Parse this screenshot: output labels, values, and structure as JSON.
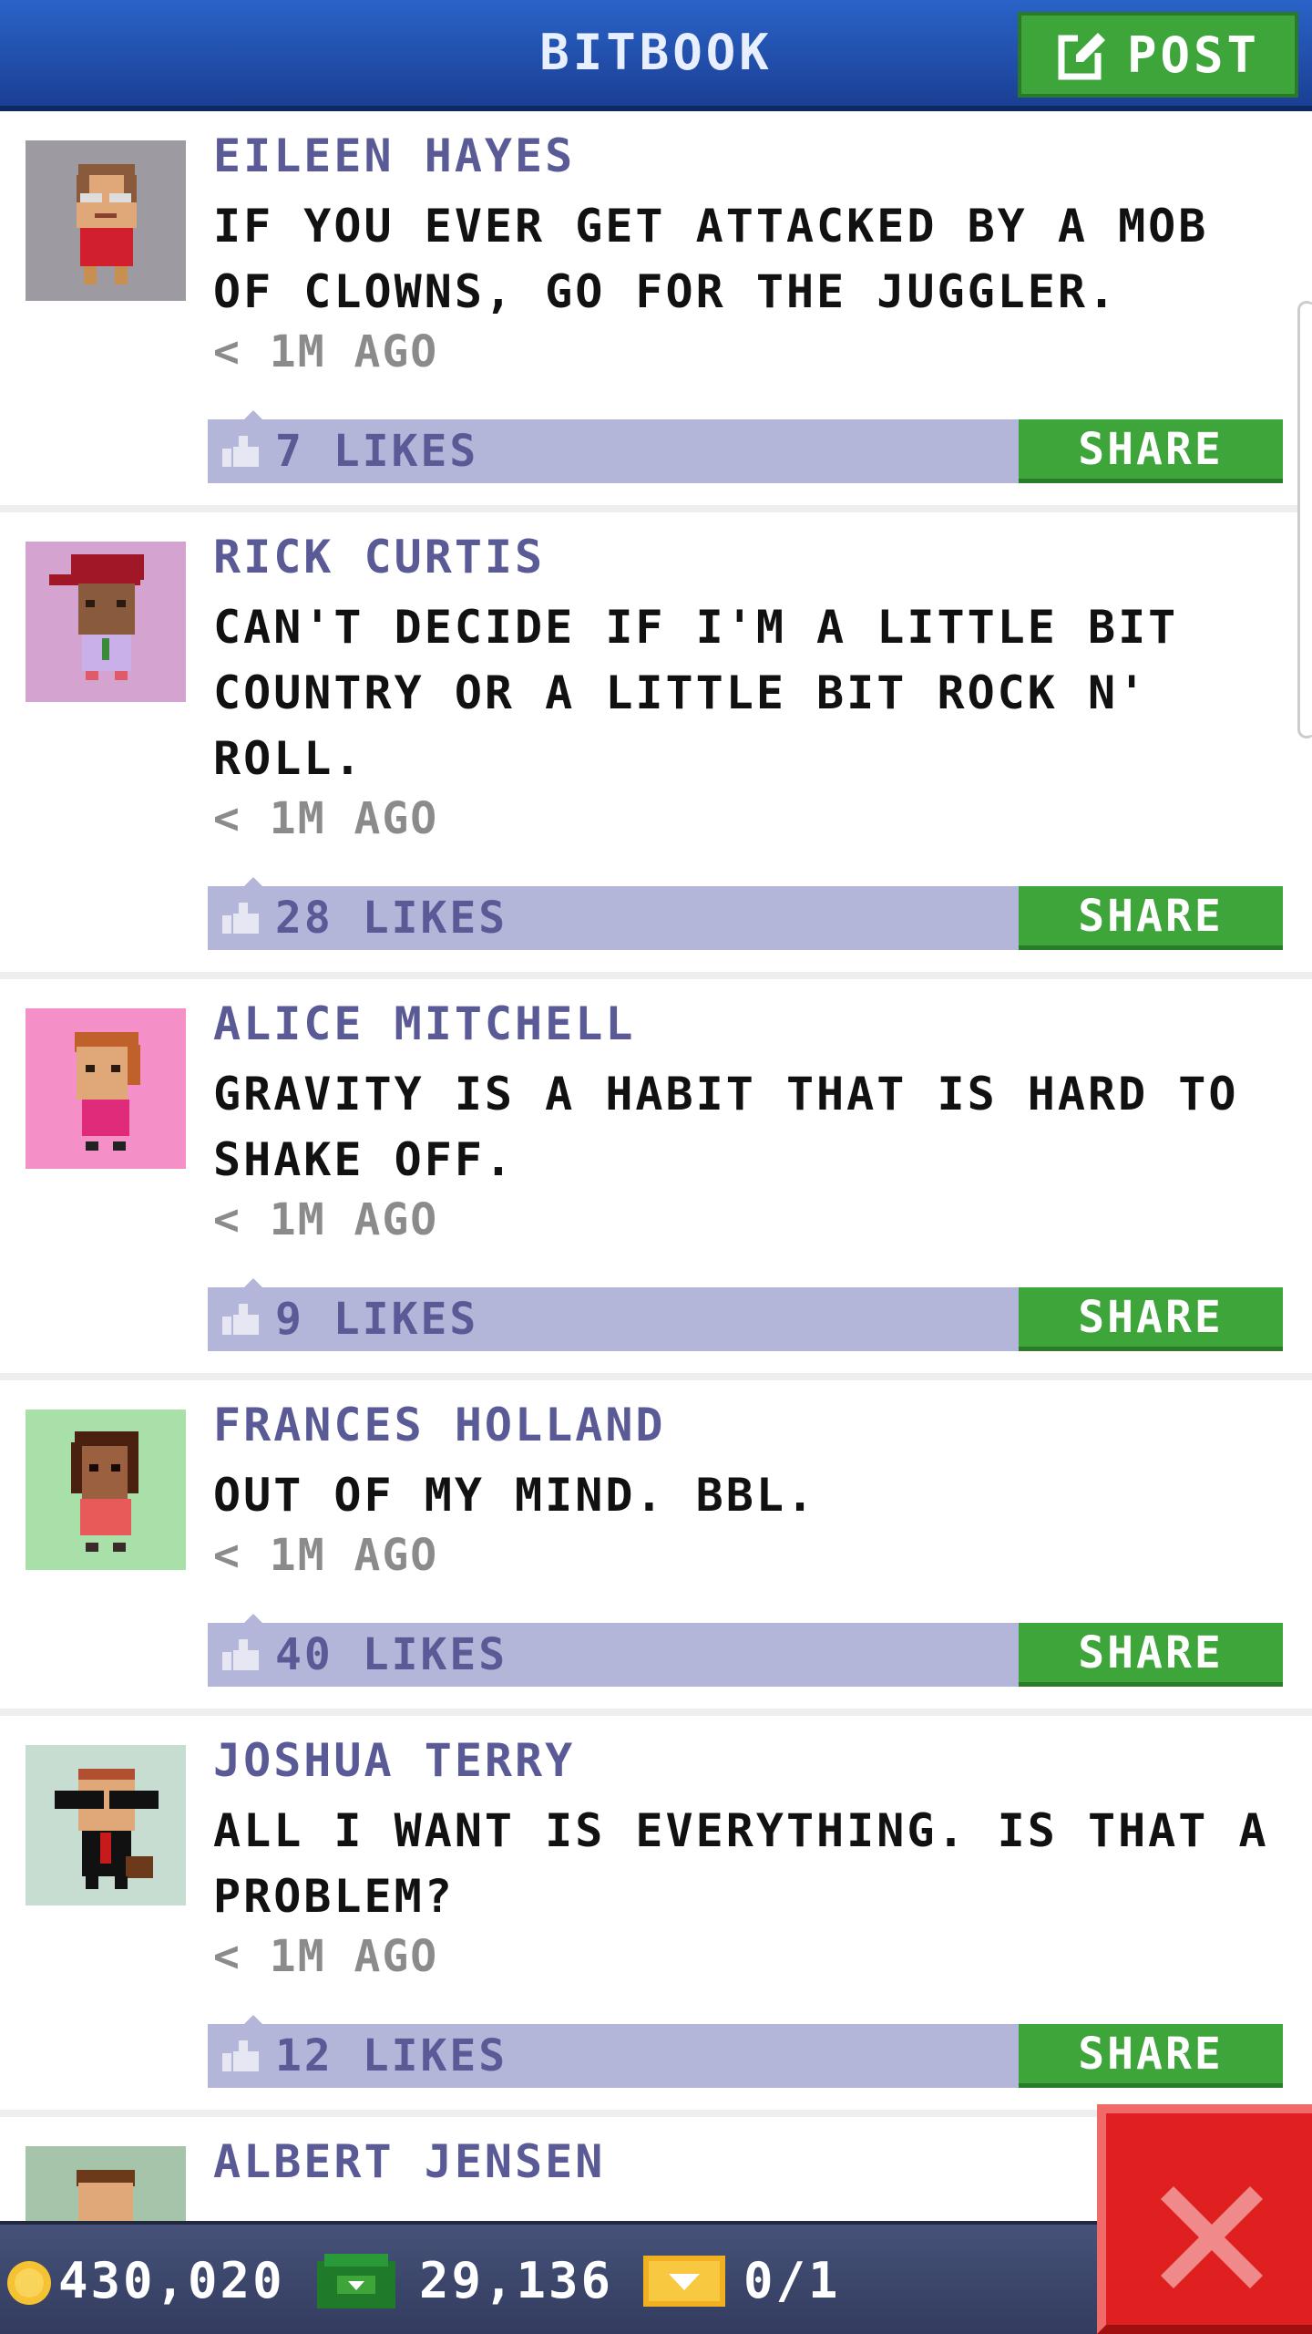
{
  "header": {
    "title": "BITBOOK",
    "post_label": "POST"
  },
  "posts": [
    {
      "author": "EILEEN HAYES",
      "message": "IF YOU EVER GET ATTACKED BY A MOB OF CLOWNS, GO FOR THE JUGGLER.",
      "time": "< 1M AGO",
      "likes": "7 LIKES",
      "share": "SHARE",
      "avatar_bg": "#9d9aa2"
    },
    {
      "author": "RICK CURTIS",
      "message": "CAN'T DECIDE IF I'M A LITTLE BIT COUNTRY OR A LITTLE BIT ROCK N' ROLL.",
      "time": "< 1M AGO",
      "likes": "28 LIKES",
      "share": "SHARE",
      "avatar_bg": "#d4a3cf"
    },
    {
      "author": "ALICE MITCHELL",
      "message": "GRAVITY IS A HABIT THAT IS HARD TO SHAKE OFF.",
      "time": "< 1M AGO",
      "likes": "9 LIKES",
      "share": "SHARE",
      "avatar_bg": "#f58fc8"
    },
    {
      "author": "FRANCES HOLLAND",
      "message": "OUT OF MY MIND. BBL.",
      "time": "< 1M AGO",
      "likes": "40 LIKES",
      "share": "SHARE",
      "avatar_bg": "#a9dfa9"
    },
    {
      "author": "JOSHUA TERRY",
      "message": "ALL I WANT IS EVERYTHING. IS THAT A PROBLEM?",
      "time": "< 1M AGO",
      "likes": "12 LIKES",
      "share": "SHARE",
      "avatar_bg": "#c7ddd2"
    },
    {
      "author": "ALBERT JENSEN",
      "avatar_bg": "#a5c4a9"
    }
  ],
  "bottom_bar": {
    "coins": "430,020",
    "bux": "29,136",
    "vip": "0/1"
  },
  "colors": {
    "header": "#2a63c8",
    "share_green": "#3ea53a",
    "like_bar": "#b3b6d9",
    "close_red": "#e02020"
  },
  "icons": {
    "post": "edit-icon",
    "like": "thumbs-up-icon",
    "coin": "coin-icon",
    "bux": "bux-icon",
    "vip": "vip-ticket-icon",
    "close": "close-icon"
  }
}
